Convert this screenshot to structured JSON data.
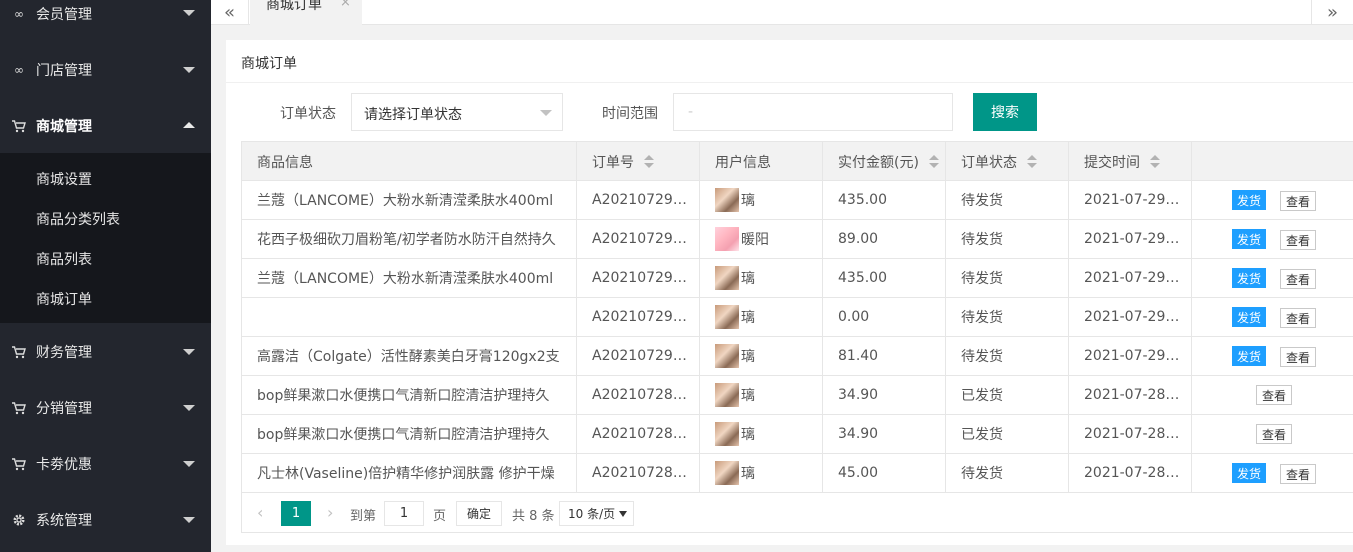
{
  "sidebar": {
    "items": [
      {
        "label": "会员管理",
        "icon": "link-icon"
      },
      {
        "label": "门店管理",
        "icon": "link-icon"
      },
      {
        "label": "商城管理",
        "icon": "cart-icon"
      },
      {
        "label": "财务管理",
        "icon": "cart-icon"
      },
      {
        "label": "分销管理",
        "icon": "cart-icon"
      },
      {
        "label": "卡劵优惠",
        "icon": "cart-icon"
      },
      {
        "label": "系统管理",
        "icon": "gear-icon"
      }
    ],
    "submenu": [
      "商城设置",
      "商品分类列表",
      "商品列表",
      "商城订单"
    ]
  },
  "tabs": {
    "prev": "«",
    "next": "»",
    "active_label": "商城订单",
    "close": "×"
  },
  "card": {
    "title": "商城订单"
  },
  "filters": {
    "status_label": "订单状态",
    "status_value": "请选择订单状态",
    "time_label": "时间范围",
    "time_value": "-",
    "search_label": "搜索"
  },
  "table": {
    "headers": [
      "商品信息",
      "订单号",
      "用户信息",
      "实付金额(元)",
      "订单状态",
      "提交时间",
      ""
    ],
    "rows": [
      {
        "product": "兰蔻（LANCOME）大粉水新清滢柔肤水400ml",
        "order_no": "A20210729…",
        "user": "璃",
        "amount": "435.00",
        "status": "待发货",
        "time": "2021-07-29 …",
        "ship": "发货",
        "view": "查看"
      },
      {
        "product": "花西子极细砍刀眉粉笔/初学者防水防汗自然持久",
        "order_no": "A20210729…",
        "user": "暖阳",
        "amount": "89.00",
        "status": "待发货",
        "time": "2021-07-29 …",
        "ship": "发货",
        "view": "查看"
      },
      {
        "product": "兰蔻（LANCOME）大粉水新清滢柔肤水400ml",
        "order_no": "A20210729…",
        "user": "璃",
        "amount": "435.00",
        "status": "待发货",
        "time": "2021-07-29 …",
        "ship": "发货",
        "view": "查看"
      },
      {
        "product": "",
        "order_no": "A20210729…",
        "user": "璃",
        "amount": "0.00",
        "status": "待发货",
        "time": "2021-07-29 …",
        "ship": "发货",
        "view": "查看"
      },
      {
        "product": "高露洁（Colgate）活性酵素美白牙膏120gx2支",
        "order_no": "A20210729…",
        "user": "璃",
        "amount": "81.40",
        "status": "待发货",
        "time": "2021-07-29 …",
        "ship": "发货",
        "view": "查看"
      },
      {
        "product": "bop鲜果漱口水便携口气清新口腔清洁护理持久",
        "order_no": "A20210728…",
        "user": "璃",
        "amount": "34.90",
        "status": "已发货",
        "time": "2021-07-28 …",
        "ship": "",
        "view": "查看"
      },
      {
        "product": "bop鲜果漱口水便携口气清新口腔清洁护理持久",
        "order_no": "A20210728…",
        "user": "璃",
        "amount": "34.90",
        "status": "已发货",
        "time": "2021-07-28 …",
        "ship": "",
        "view": "查看"
      },
      {
        "product": "凡士林(Vaseline)倍护精华修护润肤露 修护干燥",
        "order_no": "A20210728…",
        "user": "璃",
        "amount": "45.00",
        "status": "待发货",
        "time": "2021-07-28 …",
        "ship": "发货",
        "view": "查看"
      }
    ]
  },
  "pager": {
    "current": "1",
    "goto_label": "到第",
    "goto_value": "1",
    "page_unit": "页",
    "ok_label": "确定",
    "total_label": "共 8 条",
    "size_label": "10 条/页"
  }
}
